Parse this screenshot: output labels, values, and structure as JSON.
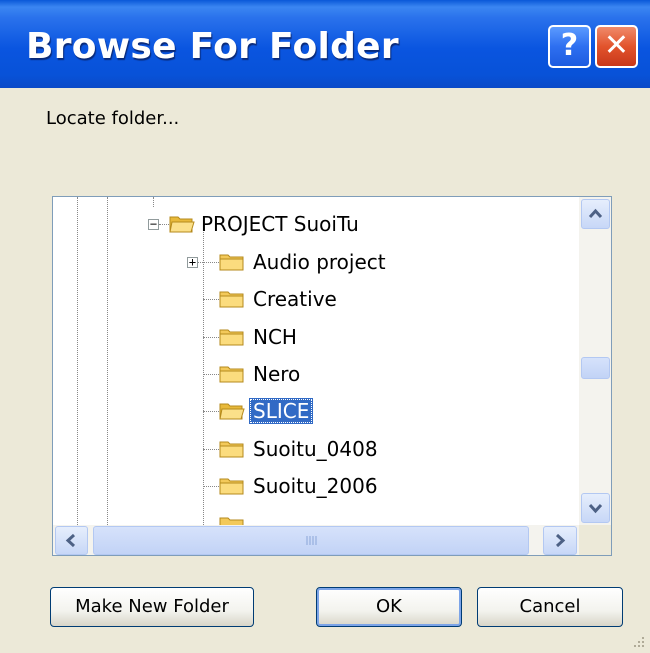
{
  "dialog": {
    "title": "Browse For Folder",
    "help_glyph": "?",
    "close_glyph": "✕",
    "description": "Locate folder..."
  },
  "tree": {
    "parent": {
      "label": "PROJECT SuoiTu",
      "expander": "−",
      "icon": "folder-open-icon"
    },
    "items": [
      {
        "label": "Audio project",
        "expander": "+",
        "icon": "folder-icon"
      },
      {
        "label": "Creative",
        "icon": "folder-icon"
      },
      {
        "label": "NCH",
        "icon": "folder-icon"
      },
      {
        "label": "Nero",
        "icon": "folder-icon"
      },
      {
        "label": "SLICE",
        "icon": "folder-open-icon",
        "selected": true
      },
      {
        "label": "Suoitu_0408",
        "icon": "folder-icon"
      },
      {
        "label": "Suoitu_2006",
        "icon": "folder-icon"
      }
    ]
  },
  "buttons": {
    "make_new_folder": "Make New Folder",
    "ok": "OK",
    "cancel": "Cancel"
  },
  "colors": {
    "titlebar": "#0A55E0",
    "selection": "#316AC5",
    "dialog_bg": "#ECE9D8"
  }
}
